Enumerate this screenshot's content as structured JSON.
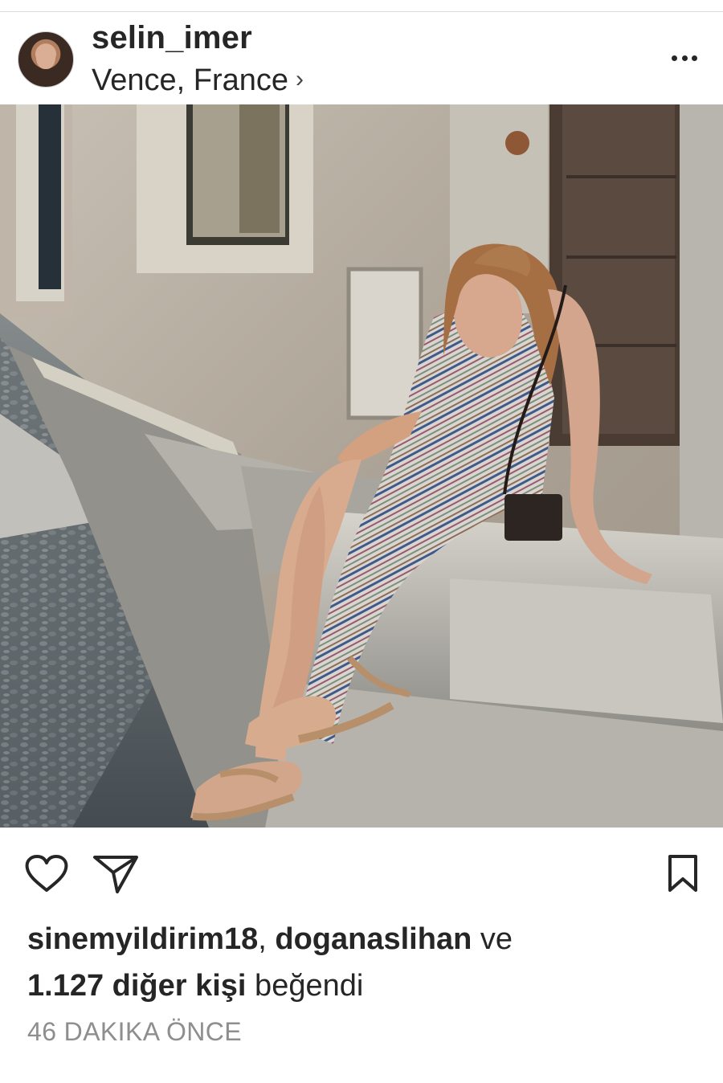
{
  "post": {
    "username": "selin_imer",
    "location": "Vence, France",
    "location_chevron_icon": "chevron-right-icon",
    "more_icon": "more-horizontal-icon",
    "photo_description": "woman seated on stone steps"
  },
  "actions": {
    "like_icon": "heart-icon",
    "share_icon": "paper-plane-icon",
    "save_icon": "bookmark-icon"
  },
  "likes": {
    "user1": "sinemyildirim18",
    "separator": ", ",
    "user2": "doganaslihan",
    "connector": " ve",
    "count_text": "1.127 diğer kişi",
    "suffix": " beğendi"
  },
  "timestamp": "46 DAKIKA ÖNCE"
}
